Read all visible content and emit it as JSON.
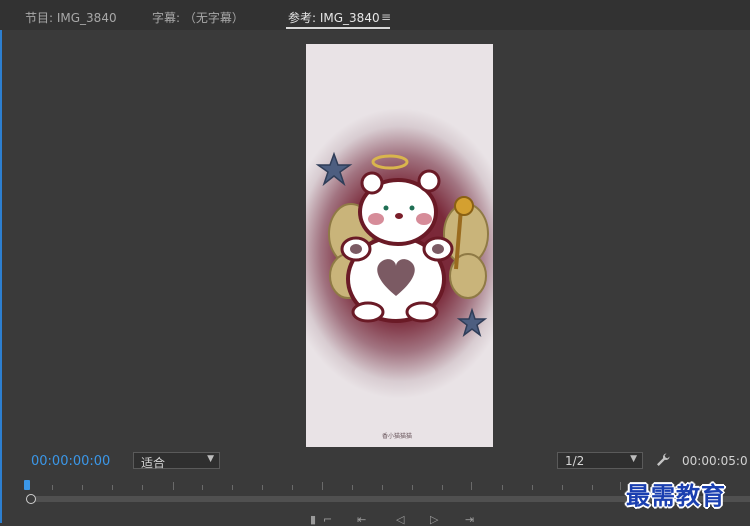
{
  "tabs": [
    {
      "label": "节目: IMG_3840",
      "active": false
    },
    {
      "label": "字幕: （无字幕）",
      "active": false
    },
    {
      "label": "参考: IMG_3840",
      "active": true
    }
  ],
  "viewer": {
    "image_caption": "香小猫猫猫"
  },
  "controls": {
    "timecode_current": "00:00:00:00",
    "zoom_select": "适合",
    "resolution_select": "1/2",
    "timecode_duration": "00:00:05:0"
  },
  "watermark": "最需教育",
  "colors": {
    "accent": "#3b97e8",
    "panel_bg": "#3a3a3a",
    "watermark": "#1a3fb0"
  },
  "icons": [
    "hamburger-menu-icon",
    "wrench-icon",
    "playhead-icon",
    "mark-in-icon",
    "step-back-icon",
    "play-icon",
    "step-forward-icon"
  ]
}
